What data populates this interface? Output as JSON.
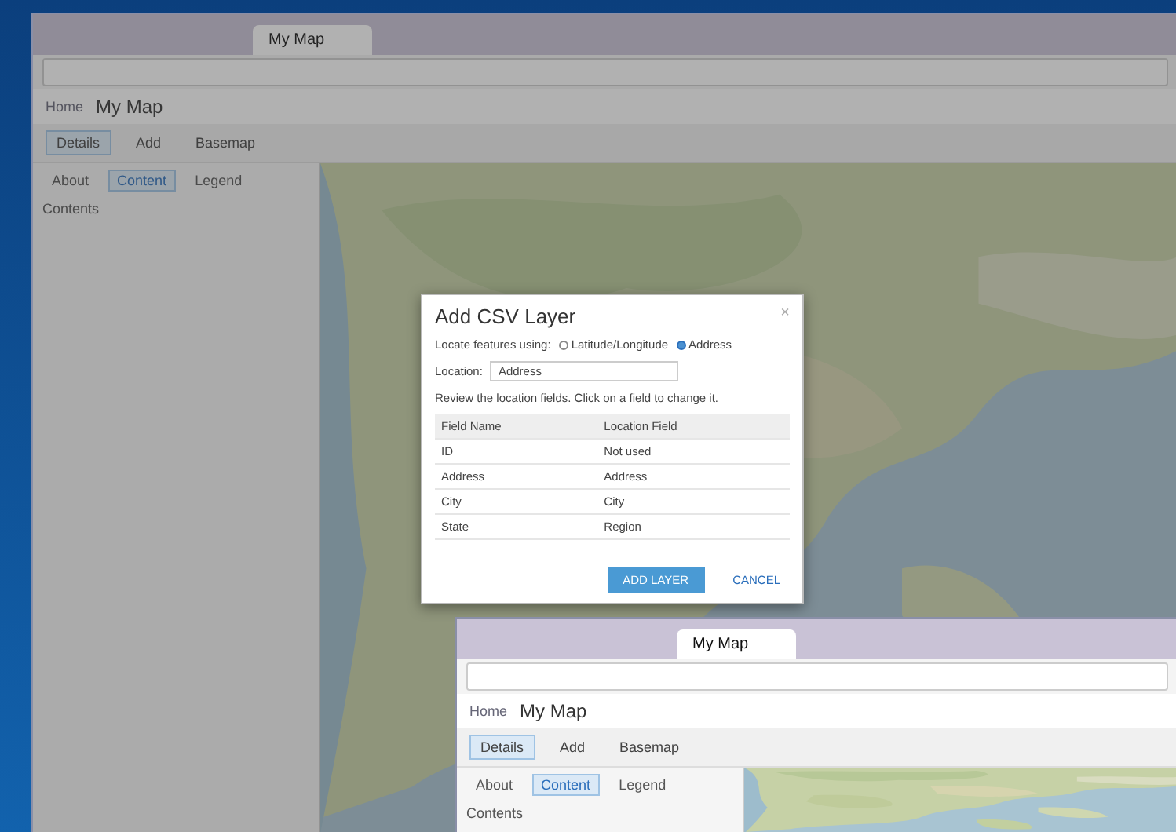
{
  "windows": [
    {
      "dimmed": true,
      "tabs": [
        {
          "label": "My Map",
          "selected": true
        }
      ],
      "breadcrumb": "Home",
      "title": "My Map",
      "tools": [
        "Details",
        "Add",
        "Basemap"
      ],
      "panel_tabs": [
        {
          "label": "About",
          "selected": false
        },
        {
          "label": "Content",
          "selected": true
        },
        {
          "label": "Legend",
          "selected": false
        }
      ],
      "panel_heading": "Contents"
    },
    {
      "dimmed": false,
      "tabs": [
        {
          "label": "My Map",
          "selected": true
        }
      ],
      "breadcrumb": "Home",
      "title": "My Map",
      "tools": [
        "Details",
        "Add",
        "Basemap"
      ],
      "panel_tabs": [
        {
          "label": "About",
          "selected": false
        },
        {
          "label": "Content",
          "selected": true
        },
        {
          "label": "Legend",
          "selected": false
        }
      ],
      "panel_heading": "Contents"
    }
  ],
  "dialog": {
    "title": "Add CSV Layer",
    "close": "×",
    "locate_label": "Locate features using:",
    "options": [
      {
        "label": "Latitude/Longitude",
        "selected": false
      },
      {
        "label": "Address",
        "selected": true
      }
    ],
    "location_label": "Location:",
    "location_value": "Address",
    "instruction": "Review the location fields. Click on a field to change it.",
    "columns": [
      "Field Name",
      "Location Field"
    ],
    "rows": [
      [
        "ID",
        "Not used"
      ],
      [
        "Address",
        "Address"
      ],
      [
        "City",
        "City"
      ],
      [
        "State",
        "Region"
      ]
    ],
    "primary_button": "ADD LAYER",
    "cancel_button": "CANCEL"
  }
}
